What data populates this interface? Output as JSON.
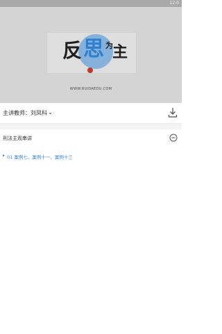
{
  "status_bar": {
    "time": "12:0"
  },
  "banner": {
    "logo_chars": [
      "反",
      "思",
      "为",
      "主"
    ],
    "url": "WWW.RUIDAEDU.COM"
  },
  "teacher": {
    "label": "主讲教师：刘凤科"
  },
  "section": {
    "title": "刑法主观串讲"
  },
  "lessons": [
    {
      "label": "01 案例七、案例十一、案例十三"
    }
  ],
  "colors": {
    "accent": "#2f7fcf",
    "banner_bg": "#d4d4d4"
  }
}
